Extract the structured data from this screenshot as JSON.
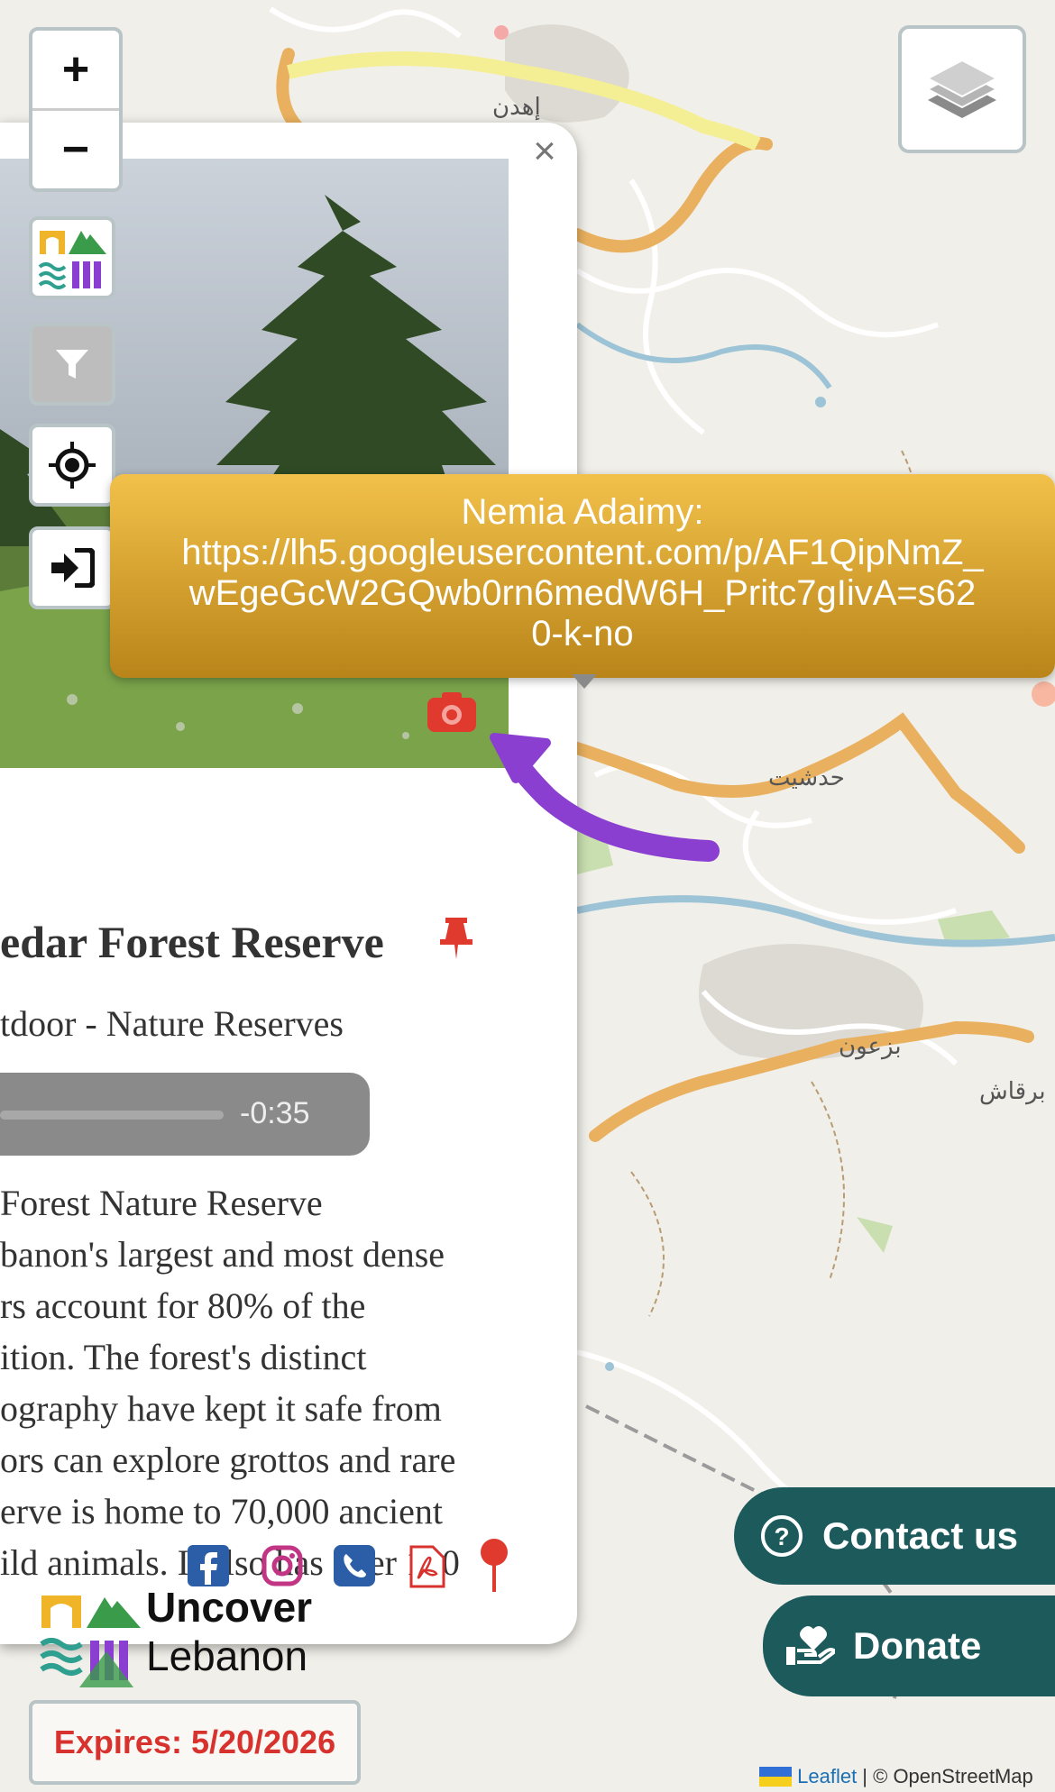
{
  "map": {
    "zoom_in": "+",
    "zoom_out": "−",
    "labels": [
      {
        "text": "إهدن",
        "name": "town-label-ehden"
      },
      {
        "text": "حدشيت",
        "name": "town-label-hadchit"
      },
      {
        "text": "بزعون",
        "name": "town-label-bazoun"
      },
      {
        "text": "برقاش",
        "name": "town-label-barkach"
      }
    ],
    "attribution": {
      "link": "Leaflet",
      "rest": " | © OpenStreetMap"
    }
  },
  "popup": {
    "close": "×",
    "title": "edar Forest Reserve",
    "category": "tdoor - Nature Reserves",
    "audio_time": "-0:35",
    "description": [
      " Forest Nature Reserve",
      "banon's largest and most dense",
      "rs account for 80% of the",
      "ition. The forest's distinct",
      "ography have kept it safe from",
      "ors can explore grottos and rare",
      "erve is home to 70,000 ancient",
      "ild animals. It also has over 100"
    ]
  },
  "tooltip": {
    "lines": [
      "Nemia Adaimy:",
      "https://lh5.googleusercontent.com/p/AF1QipNmZ_",
      "wEgeGcW2GQwb0rn6medW6H_Pritc7gIivA=s62",
      "0-k-no"
    ]
  },
  "brand": {
    "line1": "Uncover",
    "line2": "Lebanon"
  },
  "expires": "Expires: 5/20/2026",
  "buttons": {
    "contact": "Contact us",
    "donate": "Donate"
  },
  "colors": {
    "teal": "#1d5a5c",
    "red": "#d8322e",
    "gold": "#d9a22f",
    "purple": "#8a3fd1"
  }
}
